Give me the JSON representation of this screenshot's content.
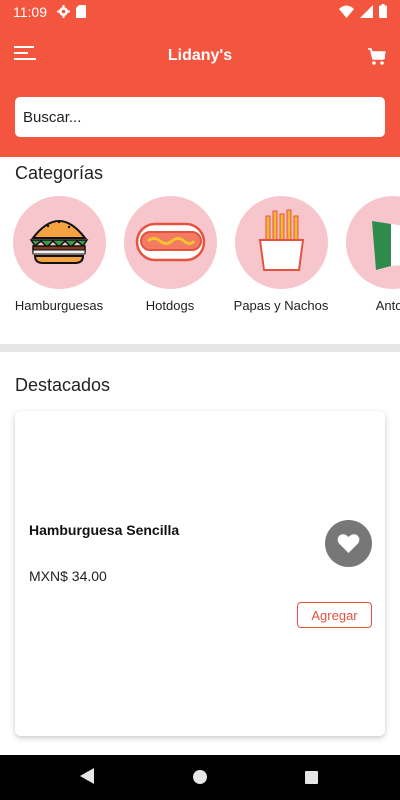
{
  "status_bar": {
    "time": "11:09",
    "icons": [
      "gear-icon",
      "sd-card-icon",
      "wifi-icon",
      "signal-icon",
      "battery-icon"
    ]
  },
  "app_bar": {
    "title": "Lidany's",
    "menu_icon": "menu-icon",
    "cart_icon": "cart-icon",
    "color": "#f4553f"
  },
  "search": {
    "placeholder": "Buscar..."
  },
  "categories": {
    "title": "Categorías",
    "items": [
      {
        "label": "Hamburguesas",
        "icon": "burger-icon"
      },
      {
        "label": "Hotdogs",
        "icon": "hotdog-icon"
      },
      {
        "label": "Papas y Nachos",
        "icon": "fries-icon"
      },
      {
        "label": "Antoji",
        "icon": "flag-icon"
      }
    ]
  },
  "featured": {
    "title": "Destacados",
    "product": {
      "name": "Hamburguesa Sencilla",
      "price": "MXN$ 34.00",
      "add_label": "Agregar",
      "favorite_icon": "heart-icon"
    }
  },
  "nav_bar": {
    "icons": [
      "back-icon",
      "home-icon",
      "recents-icon"
    ]
  },
  "colors": {
    "primary": "#f4553f",
    "category_circle": "#f7c6cc",
    "add_button": "#e5533e"
  }
}
